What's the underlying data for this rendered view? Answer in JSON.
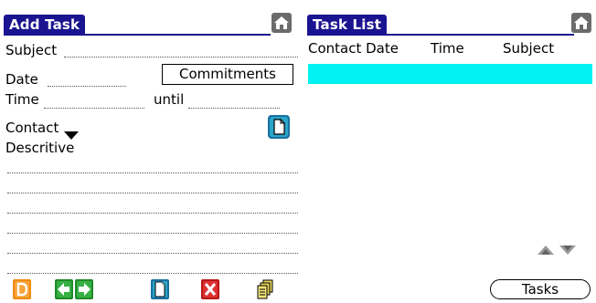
{
  "add_task": {
    "title": "Add Task",
    "subject_label": "Subject",
    "date_label": "Date",
    "commitments_button": "Commitments",
    "time_label": "Time",
    "until_label": "until",
    "contact_label": "Contact",
    "descriptive_label": "Descritive"
  },
  "task_list": {
    "title": "Task List",
    "columns": [
      "Contact Date",
      "Time",
      "Subject"
    ],
    "tasks_button": "Tasks"
  },
  "colors": {
    "title_bar": "#1b1490",
    "selected_row": "#00f2f2"
  },
  "icons": {
    "home": "home-icon",
    "note": "note-icon",
    "delete_d": "delete-icon",
    "back": "arrow-left-icon",
    "forward": "arrow-right-icon",
    "new": "new-document-icon",
    "cancel": "cancel-x-icon",
    "copy": "copy-icon",
    "scroll": "scroll-arrows-icon"
  }
}
